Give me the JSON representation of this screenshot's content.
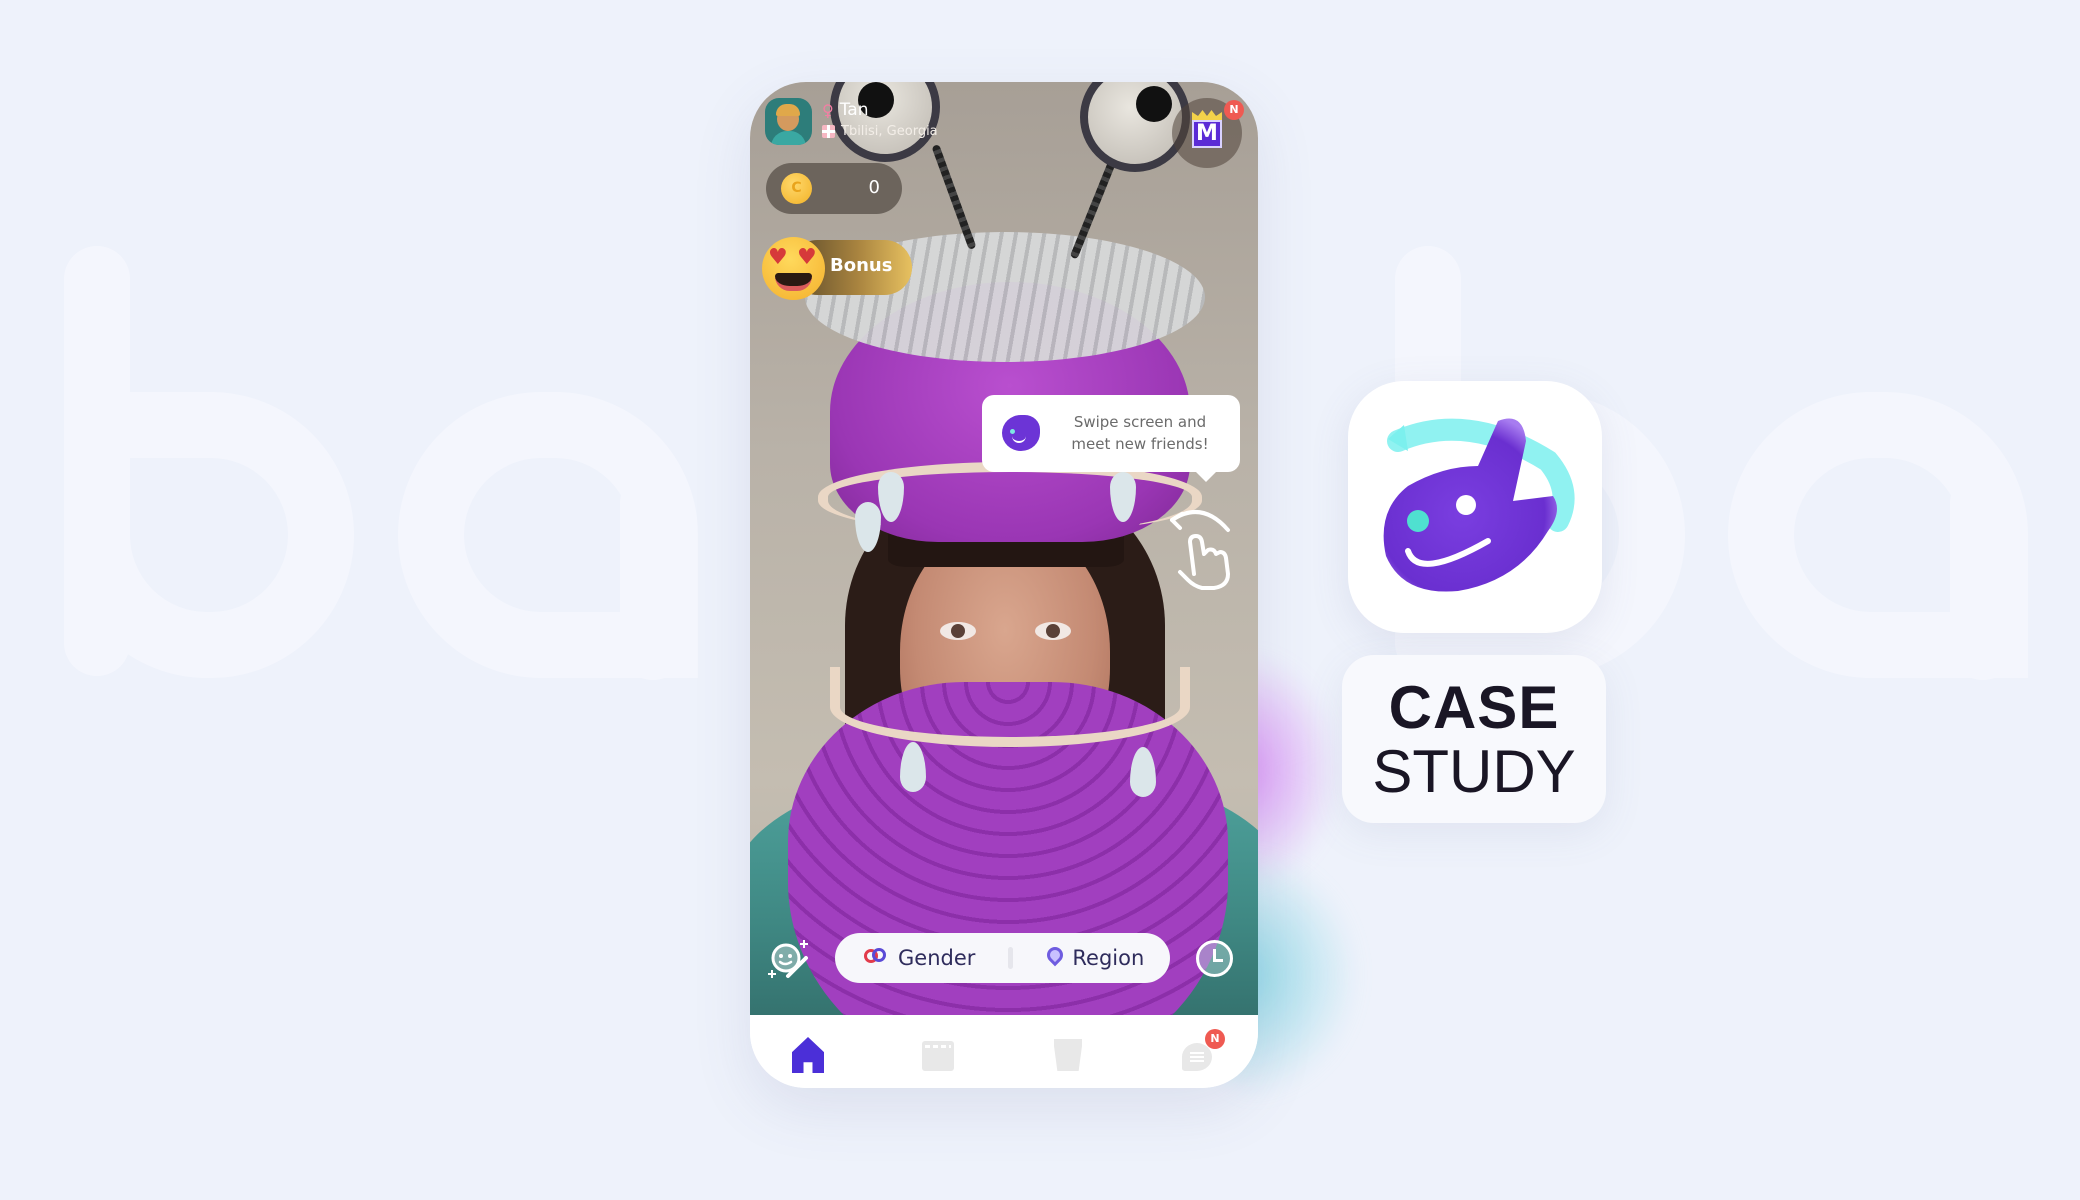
{
  "watermark": {
    "text": "ba  ba"
  },
  "profile": {
    "name": "Tan",
    "gender_icon": "female-icon",
    "location": "Tbilisi, Georgia",
    "flag_icon": "georgia-flag-icon"
  },
  "vip": {
    "icon": "vip-crown-m-icon",
    "letter": "M",
    "badge": "N"
  },
  "coins": {
    "icon": "coin-icon",
    "glyph": "C",
    "count": "0"
  },
  "bonus": {
    "label": "Bonus",
    "icon": "heart-eyes-emoji-icon"
  },
  "tooltip": {
    "text": "Swipe screen and meet new friends!",
    "icon": "app-logo-icon"
  },
  "swipe_hint": {
    "icon": "swipe-hand-icon"
  },
  "filters": {
    "magic_icon": "face-effects-icon",
    "gender": {
      "label": "Gender",
      "icon": "gender-icon"
    },
    "region": {
      "label": "Region",
      "icon": "location-pin-icon"
    },
    "history_icon": "clock-icon"
  },
  "bottom_nav": {
    "items": [
      {
        "name": "home",
        "icon": "home-icon",
        "active": true
      },
      {
        "name": "stories",
        "icon": "clapperboard-icon",
        "active": false
      },
      {
        "name": "gifts",
        "icon": "cup-heart-icon",
        "active": false
      },
      {
        "name": "messages",
        "icon": "chat-icon",
        "active": false,
        "badge": "N"
      }
    ],
    "active_color": "#4b2fd8"
  },
  "case_study": {
    "line1": "CASE",
    "line2": "STUDY"
  },
  "colors": {
    "background": "#eef2fb",
    "brand_purple": "#6c34d6",
    "brand_cyan": "#7ee7e3",
    "badge_red": "#ef5a52",
    "filter_text": "#2f2c5c"
  }
}
